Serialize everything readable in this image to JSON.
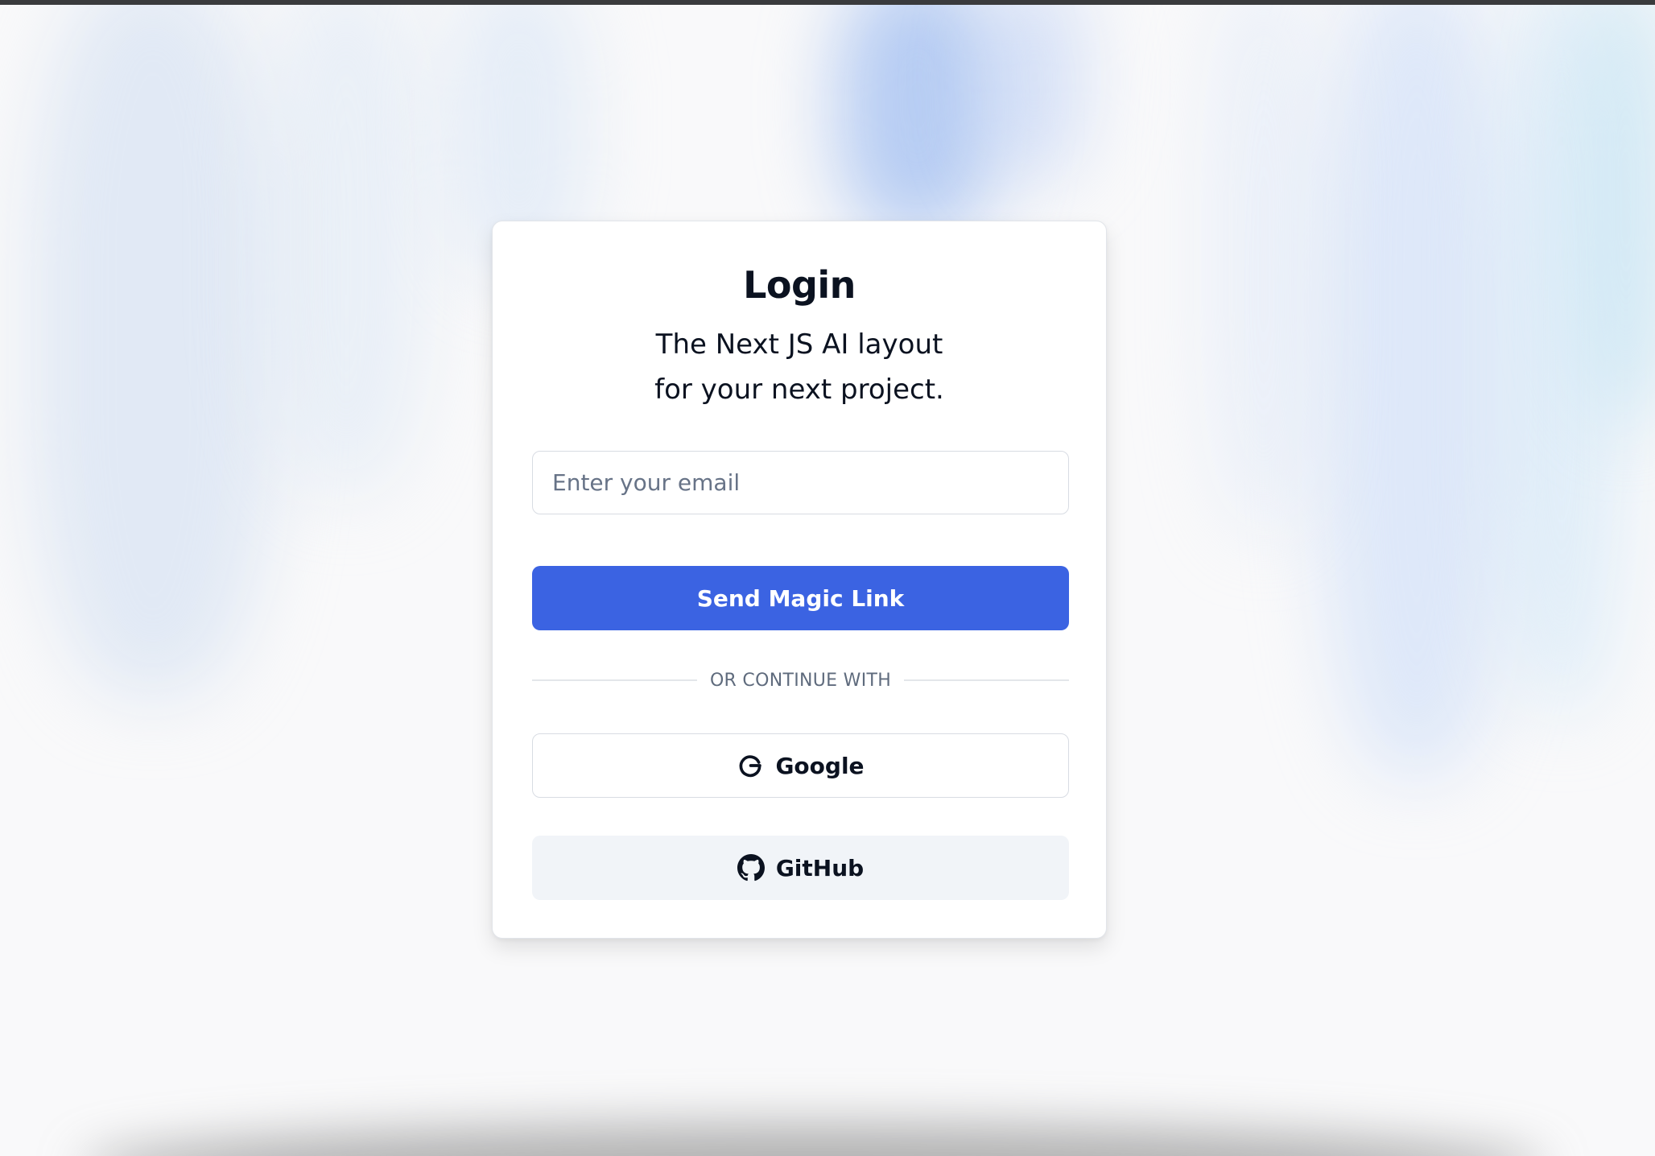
{
  "login": {
    "title": "Login",
    "subtitle_line1": "The Next JS AI layout",
    "subtitle_line2": "for your next project.",
    "email_placeholder": "Enter your email",
    "email_value": "",
    "magic_link_label": "Send Magic Link",
    "divider_text": "OR CONTINUE WITH",
    "google_label": "Google",
    "github_label": "GitHub"
  },
  "icons": {
    "google": "google-icon",
    "github": "github-icon"
  },
  "colors": {
    "accent": "#3b63e2",
    "text": "#0b1220",
    "muted": "#5f6b7d",
    "secondary_button_bg": "#f1f4f8",
    "border": "#d8dce3"
  }
}
